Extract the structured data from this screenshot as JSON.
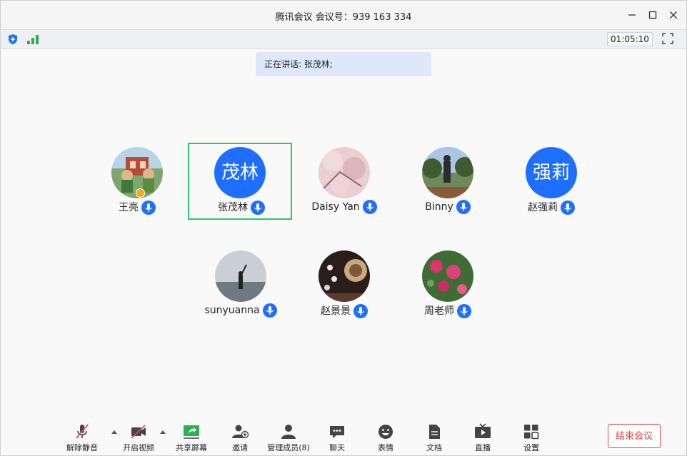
{
  "window": {
    "title": "腾讯会议 会议号：939 163 334",
    "timer": "01:05:10"
  },
  "speaking_banner": "正在讲话: 张茂林;",
  "participants": [
    {
      "name": "王亮",
      "avatar": "photo"
    },
    {
      "name": "张茂林",
      "avatar_text": "茂林",
      "active": true
    },
    {
      "name": "Daisy Yan",
      "avatar": "photo"
    },
    {
      "name": "Binny",
      "avatar": "photo"
    },
    {
      "name": "赵强莉",
      "avatar_text": "强莉"
    },
    {
      "name": "sunyuanna",
      "avatar": "photo"
    },
    {
      "name": "赵景景",
      "avatar": "photo"
    },
    {
      "name": "周老师",
      "avatar": "photo"
    }
  ],
  "toolbar": {
    "unmute": "解除静音",
    "video": "开启视频",
    "share": "共享屏幕",
    "invite": "邀请",
    "members": "管理成员(8)",
    "chat": "聊天",
    "emoji": "表情",
    "docs": "文档",
    "live": "直播",
    "settings": "设置",
    "end": "结束会议"
  },
  "colors": {
    "accent": "#1e6fff",
    "active_border": "#29c76b",
    "end_red": "#e34848"
  }
}
